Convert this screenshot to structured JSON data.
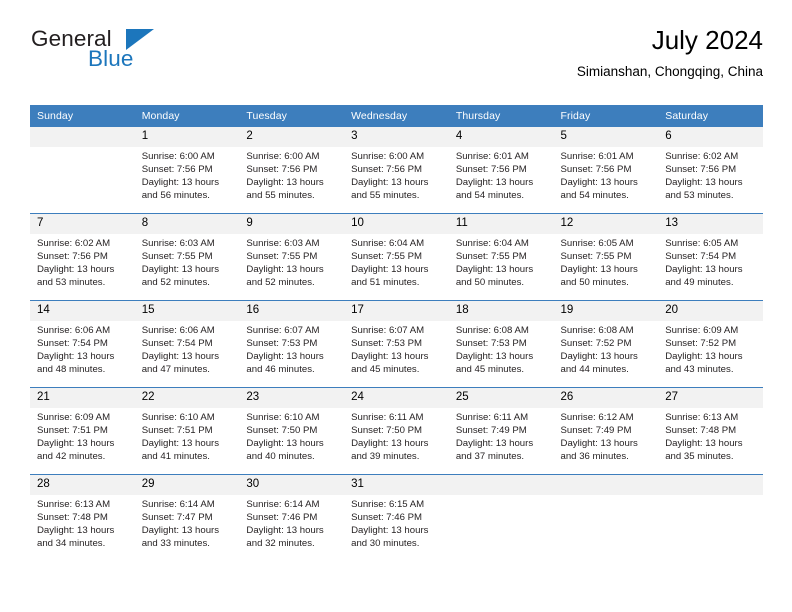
{
  "brand": {
    "name_part1": "General",
    "name_part2": "Blue",
    "logo_icon": "triangle-flag-icon",
    "color_blue": "#1c76bc",
    "color_dark": "#231f20"
  },
  "header": {
    "title": "July 2024",
    "subtitle": "Simianshan, Chongqing, China"
  },
  "theme": {
    "header_blue": "#3d7ebd",
    "daynum_bg": "#f2f2f2",
    "text": "#231f20"
  },
  "calendar": {
    "weekday_headers": [
      "Sunday",
      "Monday",
      "Tuesday",
      "Wednesday",
      "Thursday",
      "Friday",
      "Saturday"
    ],
    "weeks": [
      [
        {
          "day": "",
          "sunrise": "",
          "sunset": "",
          "daylight_line1": "",
          "daylight_line2": ""
        },
        {
          "day": "1",
          "sunrise": "Sunrise: 6:00 AM",
          "sunset": "Sunset: 7:56 PM",
          "daylight_line1": "Daylight: 13 hours",
          "daylight_line2": "and 56 minutes."
        },
        {
          "day": "2",
          "sunrise": "Sunrise: 6:00 AM",
          "sunset": "Sunset: 7:56 PM",
          "daylight_line1": "Daylight: 13 hours",
          "daylight_line2": "and 55 minutes."
        },
        {
          "day": "3",
          "sunrise": "Sunrise: 6:00 AM",
          "sunset": "Sunset: 7:56 PM",
          "daylight_line1": "Daylight: 13 hours",
          "daylight_line2": "and 55 minutes."
        },
        {
          "day": "4",
          "sunrise": "Sunrise: 6:01 AM",
          "sunset": "Sunset: 7:56 PM",
          "daylight_line1": "Daylight: 13 hours",
          "daylight_line2": "and 54 minutes."
        },
        {
          "day": "5",
          "sunrise": "Sunrise: 6:01 AM",
          "sunset": "Sunset: 7:56 PM",
          "daylight_line1": "Daylight: 13 hours",
          "daylight_line2": "and 54 minutes."
        },
        {
          "day": "6",
          "sunrise": "Sunrise: 6:02 AM",
          "sunset": "Sunset: 7:56 PM",
          "daylight_line1": "Daylight: 13 hours",
          "daylight_line2": "and 53 minutes."
        }
      ],
      [
        {
          "day": "7",
          "sunrise": "Sunrise: 6:02 AM",
          "sunset": "Sunset: 7:56 PM",
          "daylight_line1": "Daylight: 13 hours",
          "daylight_line2": "and 53 minutes."
        },
        {
          "day": "8",
          "sunrise": "Sunrise: 6:03 AM",
          "sunset": "Sunset: 7:55 PM",
          "daylight_line1": "Daylight: 13 hours",
          "daylight_line2": "and 52 minutes."
        },
        {
          "day": "9",
          "sunrise": "Sunrise: 6:03 AM",
          "sunset": "Sunset: 7:55 PM",
          "daylight_line1": "Daylight: 13 hours",
          "daylight_line2": "and 52 minutes."
        },
        {
          "day": "10",
          "sunrise": "Sunrise: 6:04 AM",
          "sunset": "Sunset: 7:55 PM",
          "daylight_line1": "Daylight: 13 hours",
          "daylight_line2": "and 51 minutes."
        },
        {
          "day": "11",
          "sunrise": "Sunrise: 6:04 AM",
          "sunset": "Sunset: 7:55 PM",
          "daylight_line1": "Daylight: 13 hours",
          "daylight_line2": "and 50 minutes."
        },
        {
          "day": "12",
          "sunrise": "Sunrise: 6:05 AM",
          "sunset": "Sunset: 7:55 PM",
          "daylight_line1": "Daylight: 13 hours",
          "daylight_line2": "and 50 minutes."
        },
        {
          "day": "13",
          "sunrise": "Sunrise: 6:05 AM",
          "sunset": "Sunset: 7:54 PM",
          "daylight_line1": "Daylight: 13 hours",
          "daylight_line2": "and 49 minutes."
        }
      ],
      [
        {
          "day": "14",
          "sunrise": "Sunrise: 6:06 AM",
          "sunset": "Sunset: 7:54 PM",
          "daylight_line1": "Daylight: 13 hours",
          "daylight_line2": "and 48 minutes."
        },
        {
          "day": "15",
          "sunrise": "Sunrise: 6:06 AM",
          "sunset": "Sunset: 7:54 PM",
          "daylight_line1": "Daylight: 13 hours",
          "daylight_line2": "and 47 minutes."
        },
        {
          "day": "16",
          "sunrise": "Sunrise: 6:07 AM",
          "sunset": "Sunset: 7:53 PM",
          "daylight_line1": "Daylight: 13 hours",
          "daylight_line2": "and 46 minutes."
        },
        {
          "day": "17",
          "sunrise": "Sunrise: 6:07 AM",
          "sunset": "Sunset: 7:53 PM",
          "daylight_line1": "Daylight: 13 hours",
          "daylight_line2": "and 45 minutes."
        },
        {
          "day": "18",
          "sunrise": "Sunrise: 6:08 AM",
          "sunset": "Sunset: 7:53 PM",
          "daylight_line1": "Daylight: 13 hours",
          "daylight_line2": "and 45 minutes."
        },
        {
          "day": "19",
          "sunrise": "Sunrise: 6:08 AM",
          "sunset": "Sunset: 7:52 PM",
          "daylight_line1": "Daylight: 13 hours",
          "daylight_line2": "and 44 minutes."
        },
        {
          "day": "20",
          "sunrise": "Sunrise: 6:09 AM",
          "sunset": "Sunset: 7:52 PM",
          "daylight_line1": "Daylight: 13 hours",
          "daylight_line2": "and 43 minutes."
        }
      ],
      [
        {
          "day": "21",
          "sunrise": "Sunrise: 6:09 AM",
          "sunset": "Sunset: 7:51 PM",
          "daylight_line1": "Daylight: 13 hours",
          "daylight_line2": "and 42 minutes."
        },
        {
          "day": "22",
          "sunrise": "Sunrise: 6:10 AM",
          "sunset": "Sunset: 7:51 PM",
          "daylight_line1": "Daylight: 13 hours",
          "daylight_line2": "and 41 minutes."
        },
        {
          "day": "23",
          "sunrise": "Sunrise: 6:10 AM",
          "sunset": "Sunset: 7:50 PM",
          "daylight_line1": "Daylight: 13 hours",
          "daylight_line2": "and 40 minutes."
        },
        {
          "day": "24",
          "sunrise": "Sunrise: 6:11 AM",
          "sunset": "Sunset: 7:50 PM",
          "daylight_line1": "Daylight: 13 hours",
          "daylight_line2": "and 39 minutes."
        },
        {
          "day": "25",
          "sunrise": "Sunrise: 6:11 AM",
          "sunset": "Sunset: 7:49 PM",
          "daylight_line1": "Daylight: 13 hours",
          "daylight_line2": "and 37 minutes."
        },
        {
          "day": "26",
          "sunrise": "Sunrise: 6:12 AM",
          "sunset": "Sunset: 7:49 PM",
          "daylight_line1": "Daylight: 13 hours",
          "daylight_line2": "and 36 minutes."
        },
        {
          "day": "27",
          "sunrise": "Sunrise: 6:13 AM",
          "sunset": "Sunset: 7:48 PM",
          "daylight_line1": "Daylight: 13 hours",
          "daylight_line2": "and 35 minutes."
        }
      ],
      [
        {
          "day": "28",
          "sunrise": "Sunrise: 6:13 AM",
          "sunset": "Sunset: 7:48 PM",
          "daylight_line1": "Daylight: 13 hours",
          "daylight_line2": "and 34 minutes."
        },
        {
          "day": "29",
          "sunrise": "Sunrise: 6:14 AM",
          "sunset": "Sunset: 7:47 PM",
          "daylight_line1": "Daylight: 13 hours",
          "daylight_line2": "and 33 minutes."
        },
        {
          "day": "30",
          "sunrise": "Sunrise: 6:14 AM",
          "sunset": "Sunset: 7:46 PM",
          "daylight_line1": "Daylight: 13 hours",
          "daylight_line2": "and 32 minutes."
        },
        {
          "day": "31",
          "sunrise": "Sunrise: 6:15 AM",
          "sunset": "Sunset: 7:46 PM",
          "daylight_line1": "Daylight: 13 hours",
          "daylight_line2": "and 30 minutes."
        },
        {
          "day": "",
          "sunrise": "",
          "sunset": "",
          "daylight_line1": "",
          "daylight_line2": ""
        },
        {
          "day": "",
          "sunrise": "",
          "sunset": "",
          "daylight_line1": "",
          "daylight_line2": ""
        },
        {
          "day": "",
          "sunrise": "",
          "sunset": "",
          "daylight_line1": "",
          "daylight_line2": ""
        }
      ]
    ]
  }
}
